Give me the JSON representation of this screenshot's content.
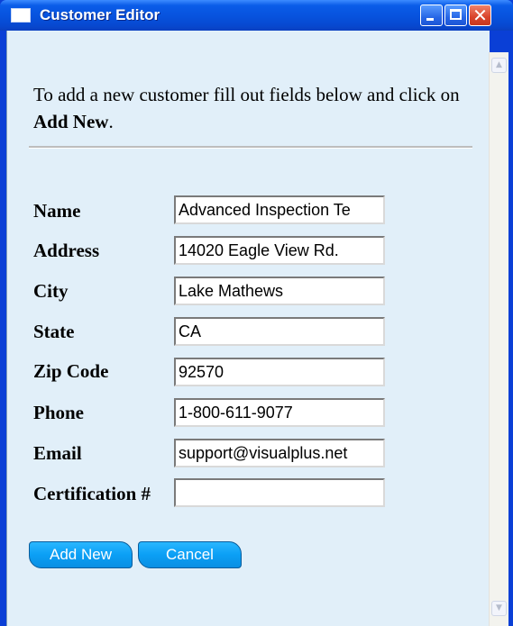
{
  "window": {
    "title": "Customer Editor",
    "minimize_icon": "minimize-icon",
    "maximize_icon": "maximize-icon",
    "close_icon": "close-icon",
    "close_glyph": "✕"
  },
  "intro": {
    "text_before": "To add a new customer fill out fields below and click on ",
    "bold_text": "Add New",
    "text_after": "."
  },
  "form": {
    "fields": [
      {
        "label": "Name",
        "value": "Advanced Inspection Te"
      },
      {
        "label": "Address",
        "value": "14020 Eagle View Rd."
      },
      {
        "label": "City",
        "value": "Lake Mathews"
      },
      {
        "label": "State",
        "value": "CA"
      },
      {
        "label": "Zip Code",
        "value": "92570"
      },
      {
        "label": "Phone",
        "value": "1-800-611-9077"
      },
      {
        "label": "Email",
        "value": "support@visualplus.net"
      },
      {
        "label": "Certification #",
        "value": ""
      }
    ]
  },
  "buttons": {
    "add_new": "Add New",
    "cancel": "Cancel"
  },
  "colors": {
    "titlebar": "#0752dd",
    "client_bg": "#e1eff9",
    "button": "#0b9ff5",
    "close_button": "#d8432a"
  }
}
